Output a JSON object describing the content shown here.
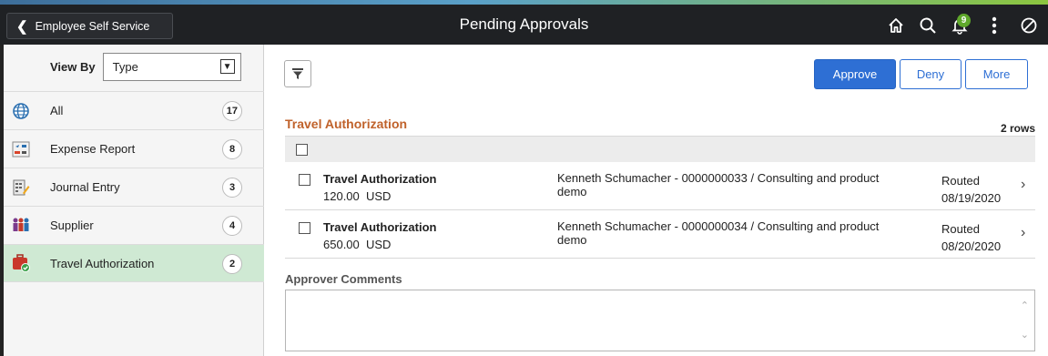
{
  "header": {
    "back_label": "Employee Self Service",
    "title": "Pending Approvals",
    "notification_count": "9",
    "icons": [
      "home-icon",
      "search-icon",
      "bell-icon",
      "kebab-menu-icon",
      "nav-bar-icon"
    ]
  },
  "sidebar": {
    "view_by_label": "View By",
    "view_by_value": "Type",
    "items": [
      {
        "label": "All",
        "count": "17",
        "icon": "globe-icon"
      },
      {
        "label": "Expense Report",
        "count": "8",
        "icon": "expense-report-icon"
      },
      {
        "label": "Journal Entry",
        "count": "3",
        "icon": "journal-entry-icon"
      },
      {
        "label": "Supplier",
        "count": "4",
        "icon": "supplier-icon"
      },
      {
        "label": "Travel Authorization",
        "count": "2",
        "icon": "travel-authorization-icon"
      }
    ],
    "active_index": 4
  },
  "toolbar": {
    "approve": "Approve",
    "deny": "Deny",
    "more": "More"
  },
  "grid": {
    "title": "Travel Authorization",
    "row_count": "2 rows",
    "rows": [
      {
        "title": "Travel Authorization",
        "amount": "120.00  USD",
        "description": "Kenneth Schumacher - 0000000033 / Consulting and product demo",
        "status": "Routed",
        "date": "08/19/2020"
      },
      {
        "title": "Travel Authorization",
        "amount": "650.00  USD",
        "description": "Kenneth Schumacher - 0000000034 / Consulting and product demo",
        "status": "Routed",
        "date": "08/20/2020"
      }
    ]
  },
  "comments": {
    "label": "Approver Comments",
    "value": ""
  },
  "colors": {
    "banner": "#1f2124",
    "accent_blue": "#2e6fd4",
    "section_title": "#c0622b",
    "active_nav": "#cfe9d3",
    "badge_green": "#5fa82b"
  }
}
